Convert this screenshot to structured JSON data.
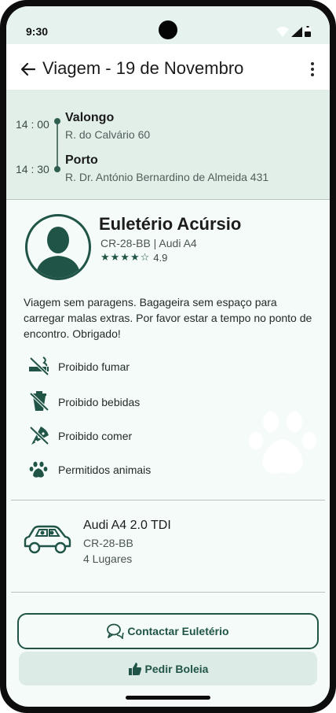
{
  "status_bar": {
    "time": "9:30"
  },
  "app_bar": {
    "title": "Viagem - 19 de Novembro"
  },
  "route": {
    "origin": {
      "time": "14 : 00",
      "city": "Valongo",
      "address": "R. do Calvário 60"
    },
    "destination": {
      "time": "14 : 30",
      "city": "Porto",
      "address": "R. Dr. António Bernardino de Almeida 431"
    }
  },
  "driver": {
    "name": "Euletério Acúrsio",
    "plate_and_car": "CR-28-BB | Audi A4",
    "rating": "4.9",
    "rating_stars": "★★★★☆",
    "rating_value": 4.9
  },
  "description": "Viagem sem paragens. Bagageira sem espaço para carregar malas extras. Por favor estar a tempo no ponto de encontro. Obrigado!",
  "rules": [
    {
      "icon": "no-smoking-icon",
      "label": "Proibido fumar"
    },
    {
      "icon": "no-drinks-icon",
      "label": "Proibido bebidas"
    },
    {
      "icon": "no-food-icon",
      "label": "Proibido comer"
    },
    {
      "icon": "paw-icon",
      "label": "Permitidos animais"
    }
  ],
  "car": {
    "model": "Audi A4 2.0 TDI",
    "plate": "CR-28-BB",
    "seats": "4 Lugares"
  },
  "actions": {
    "contact_label": "Contactar Euletério",
    "request_label": "Pedir Boleia"
  },
  "colors": {
    "accent": "#1f5446",
    "route_bg": "#e2efe9",
    "screen_bg": "#f4fbf8",
    "button_secondary_bg": "#dcebe5"
  }
}
